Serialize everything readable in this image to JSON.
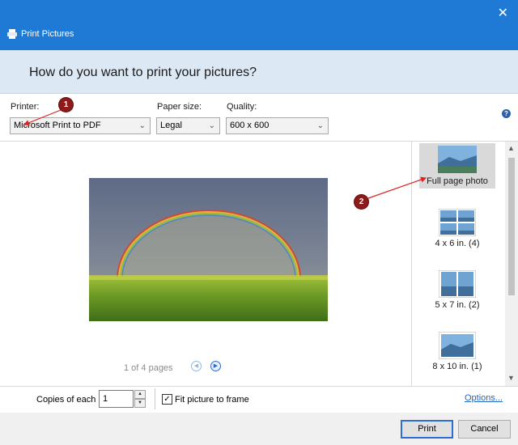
{
  "window": {
    "title": "Print Pictures",
    "close_glyph": "✕"
  },
  "header": {
    "question": "How do you want to print your pictures?"
  },
  "options": {
    "printer_label": "Printer:",
    "printer_value": "Microsoft Print to PDF",
    "paper_size_label": "Paper size:",
    "paper_size_value": "Legal",
    "quality_label": "Quality:",
    "quality_value": "600 x 600",
    "help_glyph": "?"
  },
  "preview": {
    "page_status": "1 of 4 pages",
    "prev_glyph": "◀",
    "next_glyph": "▶"
  },
  "layouts": [
    {
      "label": "Full page photo",
      "selected": true
    },
    {
      "label": "4 x 6 in. (4)",
      "selected": false
    },
    {
      "label": "5 x 7 in. (2)",
      "selected": false
    },
    {
      "label": "8 x 10 in. (1)",
      "selected": false
    }
  ],
  "bottom": {
    "copies_label": "Copies of each",
    "copies_value": "1",
    "fit_label": "Fit picture to frame",
    "fit_checked": true,
    "check_glyph": "✓",
    "options_link": "Options..."
  },
  "buttons": {
    "print": "Print",
    "cancel": "Cancel"
  },
  "annotations": [
    {
      "number": "1"
    },
    {
      "number": "2"
    }
  ],
  "colors": {
    "accent": "#1f7ad6",
    "header_bg": "#dde8f5",
    "marker": "#8e1a1a",
    "link": "#1f66c7"
  }
}
